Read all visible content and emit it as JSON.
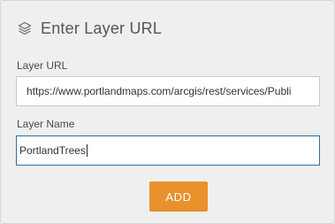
{
  "header": {
    "title": "Enter Layer URL",
    "icon": "layers-icon"
  },
  "form": {
    "url_label": "Layer URL",
    "url_value": "https://www.portlandmaps.com/arcgis/rest/services/Publi",
    "name_label": "Layer Name",
    "name_value": "PortlandTrees"
  },
  "actions": {
    "add_label": "ADD"
  },
  "colors": {
    "accent": "#e8912d",
    "focus_border": "#2e6fa3",
    "panel_bg": "#efefef"
  }
}
